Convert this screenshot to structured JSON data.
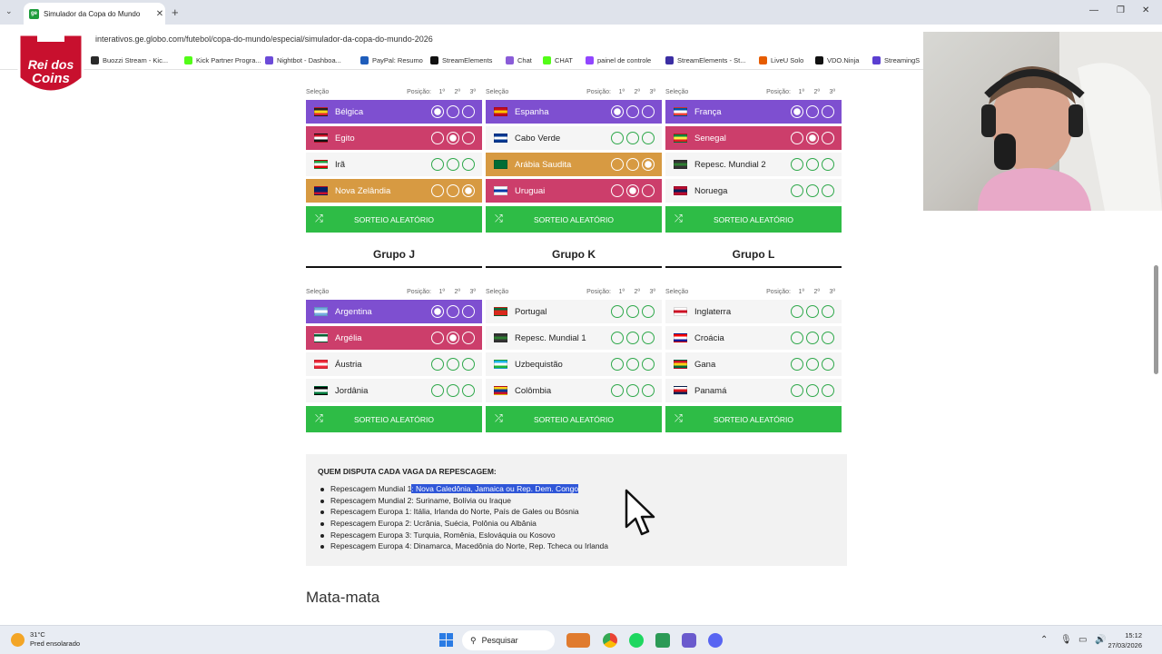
{
  "browser": {
    "tab_title": "Simulador da Copa do Mundo",
    "tab_favicon": "ge",
    "url": "interativos.ge.globo.com/futebol/copa-do-mundo/especial/simulador-da-copa-do-mundo-2026",
    "bookmarks": [
      "Buozzi Stream - Kic...",
      "Kick Partner Progra...",
      "Nightbot - Dashboa...",
      "PayPal: Resumo",
      "StreamElements",
      "Chat",
      "CHAT",
      "painel de controle",
      "StreamElements - St...",
      "LiveU Solo",
      "VDO.Ninja",
      "StreamingS"
    ]
  },
  "overlay": {
    "logo_line1": "Rei dos",
    "logo_line2": "Coins"
  },
  "table_header": {
    "selecao": "Seleção",
    "posicao": "Posição:",
    "p1": "1º",
    "p2": "2º",
    "p3": "3º"
  },
  "random_button": "SORTEIO ALEATÓRIO",
  "groups_top": [
    {
      "teams": [
        {
          "name": "Bélgica",
          "pos": 1,
          "flag": [
            "#222222",
            "#f6d41c",
            "#e2252e"
          ]
        },
        {
          "name": "Egito",
          "pos": 2,
          "flag": [
            "#ce1126",
            "#ffffff",
            "#111111"
          ]
        },
        {
          "name": "Irã",
          "pos": 0,
          "flag": [
            "#239f40",
            "#ffffff",
            "#da0000"
          ]
        },
        {
          "name": "Nova Zelândia",
          "pos": 3,
          "flag": [
            "#012169",
            "#012169",
            "#c8102e"
          ]
        }
      ]
    },
    {
      "teams": [
        {
          "name": "Espanha",
          "pos": 1,
          "flag": [
            "#c60b1e",
            "#ffc400",
            "#c60b1e"
          ]
        },
        {
          "name": "Cabo Verde",
          "pos": 0,
          "flag": [
            "#003893",
            "#ffffff",
            "#003893"
          ]
        },
        {
          "name": "Arábia Saudita",
          "pos": 3,
          "flag": [
            "#006c35",
            "#006c35",
            "#006c35"
          ]
        },
        {
          "name": "Uruguai",
          "pos": 2,
          "flag": [
            "#ffffff",
            "#0038a8",
            "#ffffff"
          ]
        }
      ]
    },
    {
      "teams": [
        {
          "name": "França",
          "pos": 1,
          "flag": [
            "#0055a4",
            "#ffffff",
            "#ef4135"
          ]
        },
        {
          "name": "Senegal",
          "pos": 2,
          "flag": [
            "#00853f",
            "#fdef42",
            "#e31b23"
          ]
        },
        {
          "name": "Repesc. Mundial 2",
          "pos": 0,
          "flag": [
            "#333333",
            "#2e7d32",
            "#333333"
          ]
        },
        {
          "name": "Noruega",
          "pos": 0,
          "flag": [
            "#ba0c2f",
            "#00205b",
            "#ba0c2f"
          ]
        }
      ]
    }
  ],
  "groups_bottom": [
    {
      "title": "Grupo J",
      "teams": [
        {
          "name": "Argentina",
          "pos": 1,
          "flag": [
            "#74acdf",
            "#ffffff",
            "#74acdf"
          ]
        },
        {
          "name": "Argélia",
          "pos": 2,
          "flag": [
            "#006233",
            "#ffffff",
            "#ffffff"
          ]
        },
        {
          "name": "Áustria",
          "pos": 0,
          "flag": [
            "#ed2939",
            "#ffffff",
            "#ed2939"
          ]
        },
        {
          "name": "Jordânia",
          "pos": 0,
          "flag": [
            "#000000",
            "#ffffff",
            "#007a3d"
          ]
        }
      ]
    },
    {
      "title": "Grupo K",
      "teams": [
        {
          "name": "Portugal",
          "pos": 0,
          "flag": [
            "#046a38",
            "#da291c",
            "#da291c"
          ]
        },
        {
          "name": "Repesc. Mundial 1",
          "pos": 0,
          "flag": [
            "#333333",
            "#2e7d32",
            "#333333"
          ]
        },
        {
          "name": "Uzbequistão",
          "pos": 0,
          "flag": [
            "#1eb5e8",
            "#ffffff",
            "#1eb53a"
          ]
        },
        {
          "name": "Colômbia",
          "pos": 0,
          "flag": [
            "#fcd116",
            "#003893",
            "#ce1126"
          ]
        }
      ]
    },
    {
      "title": "Grupo L",
      "teams": [
        {
          "name": "Inglaterra",
          "pos": 0,
          "flag": [
            "#ffffff",
            "#ce1124",
            "#ffffff"
          ]
        },
        {
          "name": "Croácia",
          "pos": 0,
          "flag": [
            "#ff0000",
            "#ffffff",
            "#171796"
          ]
        },
        {
          "name": "Gana",
          "pos": 0,
          "flag": [
            "#ce1126",
            "#fcd116",
            "#006b3f"
          ]
        },
        {
          "name": "Panamá",
          "pos": 0,
          "flag": [
            "#ffffff",
            "#da121a",
            "#072357"
          ]
        }
      ]
    }
  ],
  "repescagem": {
    "title": "QUEM DISPUTA CADA VAGA DA REPESCAGEM:",
    "first_prefix": "Repescagem Mundial 1",
    "first_highlight": ": Nova Caledônia, Jamaica ou Rep. Dem. Congo",
    "items": [
      "Repescagem Mundial 2: Suriname, Bolívia ou Iraque",
      "Repescagem Europa 1: Itália, Irlanda do Norte, País de Gales ou Bósnia",
      "Repescagem Europa 2: Ucrânia, Suécia, Polônia ou Albânia",
      "Repescagem Europa 3: Turquia, Romênia, Eslováquia ou Kosovo",
      "Repescagem Europa 4: Dinamarca, Macedônia do Norte, Rep. Tcheca ou Irlanda"
    ]
  },
  "section_title": "Mata-mata",
  "taskbar": {
    "temp": "31°C",
    "weather": "Pred ensolarado",
    "search": "Pesquisar",
    "time": "15:12",
    "date": "27/03/2026"
  },
  "colors": {
    "first": "#7e4fd0",
    "second": "#cc3e6b",
    "third": "#d79a42",
    "button": "#2ebc46"
  }
}
